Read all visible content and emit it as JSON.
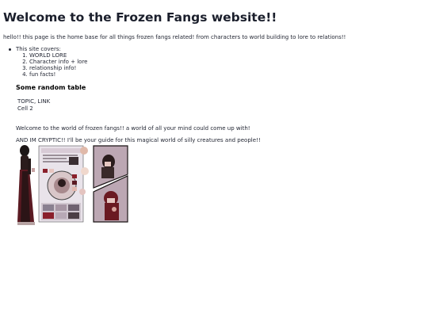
{
  "page": {
    "heading": "Welcome to the Frozen Fangs website!!",
    "intro": "hello!! this page is the home base for all things frozen fangs related! from characters to world building to lore to relations!!"
  },
  "covers": {
    "label": "This site covers:",
    "items": [
      "WORLD LORE",
      "Character info + lore",
      "relationship info!",
      "fun facts!"
    ]
  },
  "table": {
    "title": "Some random table",
    "rows": [
      [
        "TOPIC, LINK"
      ],
      [
        "Cell 2"
      ]
    ]
  },
  "paragraphs": {
    "welcome": "Welcome to the world of frozen fangs!! a world of all your mind could come up with!",
    "crypt": "AND IM CRYPTIC!! I'll be your guide for this magical world of silly creatures and people!!"
  },
  "artwork": {
    "card_text": "*CRYPTIC COLLECTION* -CRYPTIC-",
    "colors": {
      "accent": "#8a1f2b",
      "dark": "#1a1414",
      "panel": "#bca7b3",
      "card": "#e9e3ea"
    }
  }
}
